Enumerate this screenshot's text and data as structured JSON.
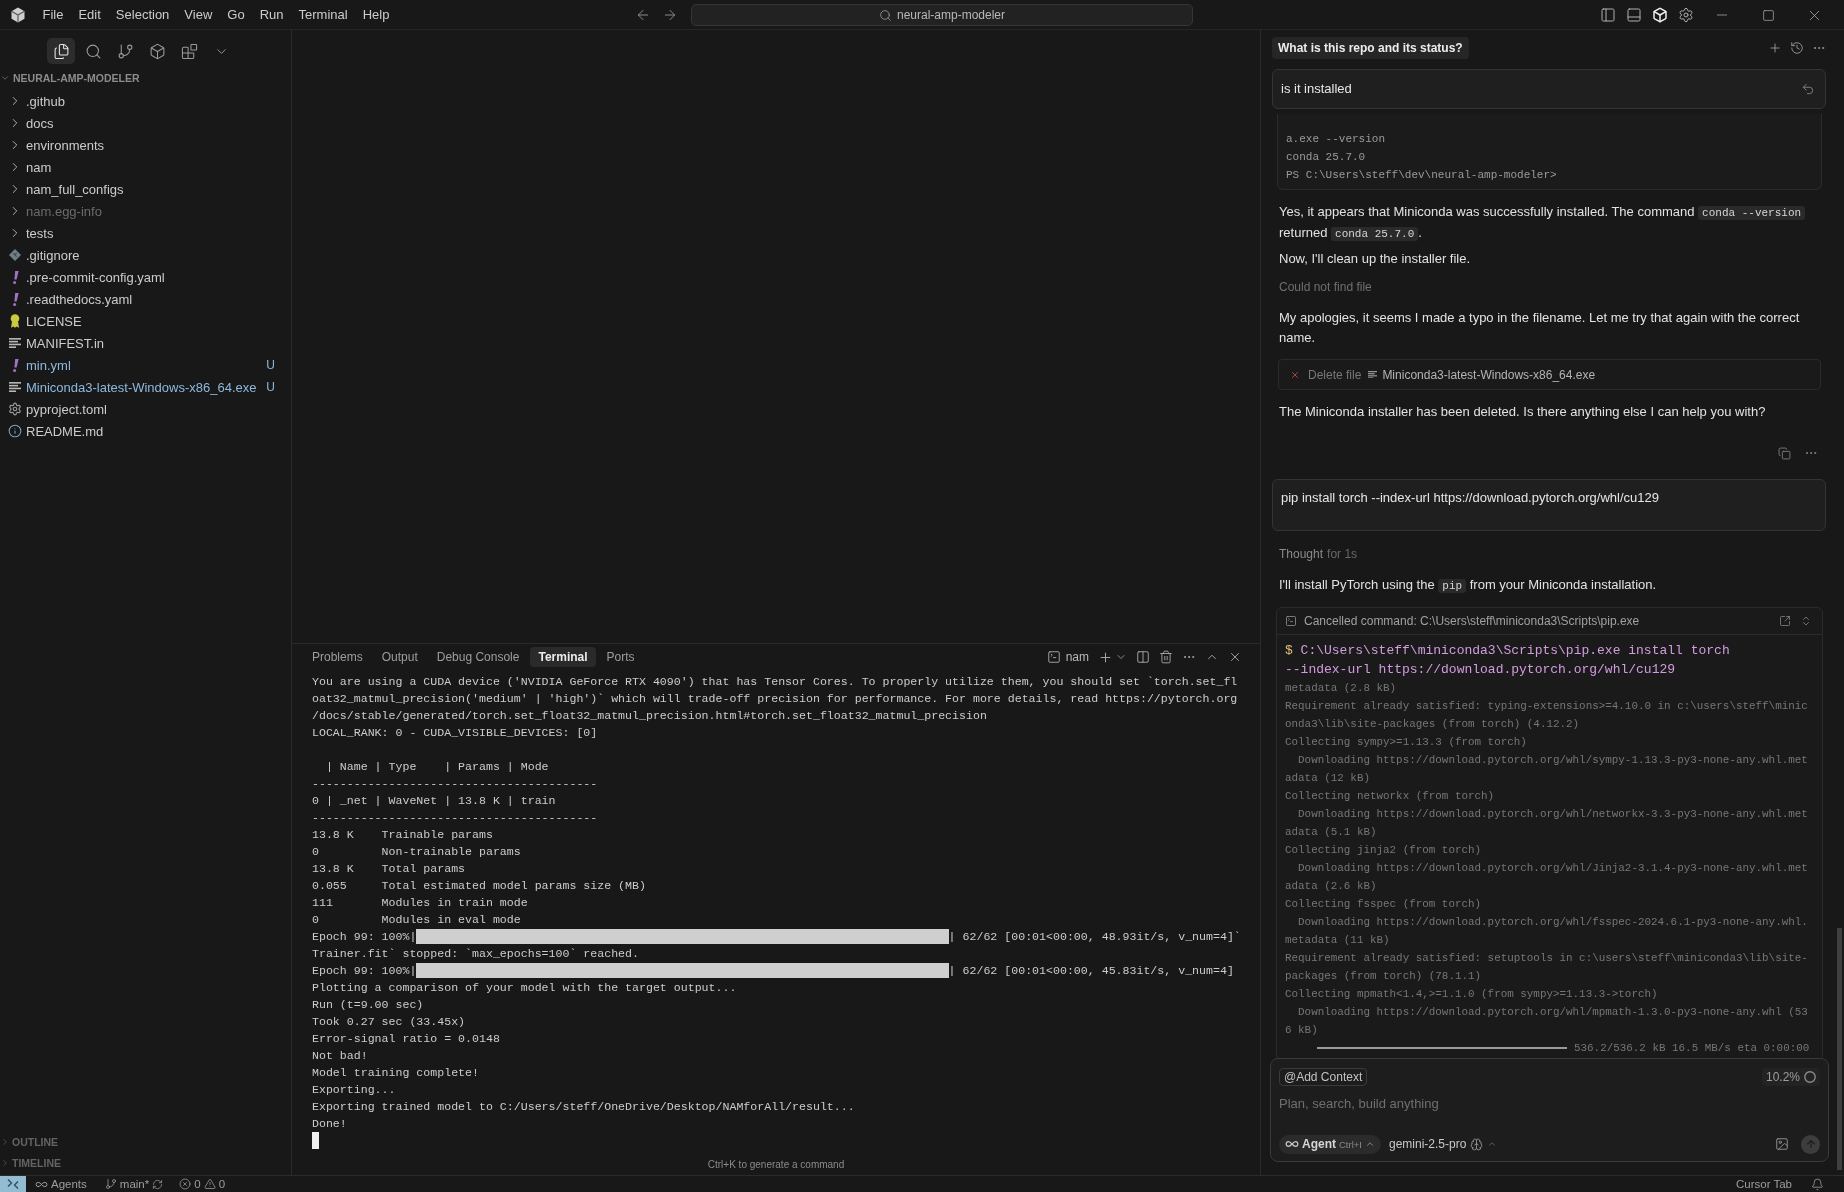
{
  "title_bar": {
    "menu": [
      "File",
      "Edit",
      "Selection",
      "View",
      "Go",
      "Run",
      "Terminal",
      "Help"
    ],
    "search": "neural-amp-modeler"
  },
  "view_bar": [
    {
      "kind": "explorer",
      "selected": true
    },
    {
      "kind": "search",
      "selected": false
    },
    {
      "kind": "git",
      "selected": false
    },
    {
      "kind": "cube",
      "selected": false
    },
    {
      "kind": "grid",
      "selected": false
    }
  ],
  "sidebar": {
    "title": "NEURAL-AMP-MODELER",
    "expanded": true,
    "items": [
      {
        "name": ".github",
        "kind": "folder",
        "expanded": false,
        "ignored": false,
        "untracked": false
      },
      {
        "name": "docs",
        "kind": "folder",
        "expanded": false,
        "ignored": false,
        "untracked": false
      },
      {
        "name": "environments",
        "kind": "folder",
        "expanded": false,
        "ignored": false,
        "untracked": false
      },
      {
        "name": "nam",
        "kind": "folder",
        "expanded": false,
        "ignored": false,
        "untracked": false
      },
      {
        "name": "nam_full_configs",
        "kind": "folder",
        "expanded": false,
        "ignored": false,
        "untracked": false
      },
      {
        "name": "nam.egg-info",
        "kind": "folder",
        "expanded": false,
        "ignored": true,
        "untracked": false
      },
      {
        "name": "tests",
        "kind": "folder",
        "expanded": false,
        "ignored": false,
        "untracked": false
      },
      {
        "name": ".gitignore",
        "kind": "git",
        "ignored": false,
        "untracked": false
      },
      {
        "name": ".pre-commit-config.yaml",
        "kind": "yaml",
        "ignored": false,
        "untracked": false
      },
      {
        "name": ".readthedocs.yaml",
        "kind": "yaml",
        "ignored": false,
        "untracked": false
      },
      {
        "name": "LICENSE",
        "kind": "license",
        "ignored": false,
        "untracked": false
      },
      {
        "name": "MANIFEST.in",
        "kind": "text",
        "ignored": false,
        "untracked": false
      },
      {
        "name": "min.yml",
        "kind": "yaml",
        "ignored": false,
        "untracked": true,
        "badge": "U"
      },
      {
        "name": "Miniconda3-latest-Windows-x86_64.exe",
        "kind": "text",
        "ignored": false,
        "untracked": true,
        "badge": "U"
      },
      {
        "name": "pyproject.toml",
        "kind": "toml",
        "ignored": false,
        "untracked": false
      },
      {
        "name": "README.md",
        "kind": "info",
        "ignored": false,
        "untracked": false
      }
    ],
    "sections": [
      {
        "title": "OUTLINE",
        "expanded": false
      },
      {
        "title": "TIMELINE",
        "expanded": false
      }
    ]
  },
  "panel": {
    "tabs": [
      {
        "label": "Problems",
        "selected": false
      },
      {
        "label": "Output",
        "selected": false
      },
      {
        "label": "Debug Console",
        "selected": false
      },
      {
        "label": "Terminal",
        "selected": true
      },
      {
        "label": "Ports",
        "selected": false
      }
    ],
    "shell": "nam",
    "lines": [
      {
        "kind": "text",
        "text": "You are using a CUDA device ('NVIDIA GeForce RTX 4090') that has Tensor Cores. To properly utilize them, you should set `torch.set_fl"
      },
      {
        "kind": "text",
        "text": "oat32_matmul_precision('medium' | 'high')` which will trade-off precision for performance. For more details, read https://pytorch.org"
      },
      {
        "kind": "text",
        "text": "/docs/stable/generated/torch.set_float32_matmul_precision.html#torch.set_float32_matmul_precision"
      },
      {
        "kind": "text",
        "text": "LOCAL_RANK: 0 - CUDA_VISIBLE_DEVICES: [0]"
      },
      {
        "kind": "blank"
      },
      {
        "kind": "text",
        "text": "  | Name | Type    | Params | Mode"
      },
      {
        "kind": "text",
        "text": "-----------------------------------------"
      },
      {
        "kind": "text",
        "text": "0 | _net | WaveNet | 13.8 K | train"
      },
      {
        "kind": "text",
        "text": "-----------------------------------------"
      },
      {
        "kind": "text",
        "text": "13.8 K    Trainable params"
      },
      {
        "kind": "text",
        "text": "0         Non-trainable params"
      },
      {
        "kind": "text",
        "text": "13.8 K    Total params"
      },
      {
        "kind": "text",
        "text": "0.055     Total estimated model params size (MB)"
      },
      {
        "kind": "text",
        "text": "111       Modules in train mode"
      },
      {
        "kind": "text",
        "text": "0         Modules in eval mode"
      },
      {
        "kind": "progress",
        "prefix": "Epoch 99: 100%|",
        "level": 1,
        "suffix": "| 62/62 [00:01<00:00, 48.93it/s, v_num=4]`"
      },
      {
        "kind": "text",
        "text": "Trainer.fit` stopped: `max_epochs=100` reached."
      },
      {
        "kind": "progress",
        "prefix": "Epoch 99: 100%|",
        "level": 1,
        "suffix": "| 62/62 [00:01<00:00, 45.83it/s, v_num=4]"
      },
      {
        "kind": "text",
        "text": "Plotting a comparison of your model with the target output..."
      },
      {
        "kind": "text",
        "text": "Run (t=9.00 sec)"
      },
      {
        "kind": "text",
        "text": "Took 0.27 sec (33.45x)"
      },
      {
        "kind": "text",
        "text": "Error-signal ratio = 0.0148"
      },
      {
        "kind": "text",
        "text": "Not bad!"
      },
      {
        "kind": "text",
        "text": "Model training complete!"
      },
      {
        "kind": "text",
        "text": "Exporting..."
      },
      {
        "kind": "text",
        "text": "Exporting trained model to C:/Users/steff/OneDrive/Desktop/NAMforAll/result..."
      },
      {
        "kind": "text",
        "text": "Done!"
      },
      {
        "kind": "cursor"
      }
    ],
    "hint": "Ctrl+K to generate a command"
  },
  "chat": {
    "title": "What is this repo and its status?",
    "blocks": [
      {
        "kind": "user",
        "text": "is it installed",
        "restorable": true
      },
      {
        "kind": "output",
        "lines": [
          "a.exe --version",
          "conda 25.7.0",
          "PS C:\\Users\\steff\\dev\\neural-amp-modeler>"
        ]
      },
      {
        "kind": "text",
        "parts": [
          {
            "kind": "plain",
            "text": "Yes, it appears that Miniconda was successfully installed. The command "
          },
          {
            "kind": "code",
            "text": "conda --version"
          },
          {
            "kind": "plain",
            "text": " returned "
          },
          {
            "kind": "code",
            "text": "conda 25.7.0"
          },
          {
            "kind": "plain",
            "text": "."
          }
        ]
      },
      {
        "kind": "text",
        "parts": [
          {
            "kind": "plain",
            "text": "Now, I'll clean up the installer file."
          }
        ]
      },
      {
        "kind": "note",
        "text": "Could not find file"
      },
      {
        "kind": "text",
        "parts": [
          {
            "kind": "plain",
            "text": "My apologies, it seems I made a typo in the filename. Let me try that again with the correct name."
          }
        ]
      },
      {
        "kind": "file_action",
        "action": "Delete file",
        "file": "Miniconda3-latest-Windows-x86_64.exe"
      },
      {
        "kind": "text",
        "parts": [
          {
            "kind": "plain",
            "text": "The Miniconda installer has been deleted. Is there anything else I can help you with?"
          }
        ]
      },
      {
        "kind": "actions"
      },
      {
        "kind": "user",
        "text": "pip install torch --index-url https://download.pytorch.org/whl/cu129",
        "restorable": false
      },
      {
        "kind": "thought",
        "label": "Thought",
        "duration": "for 1s"
      },
      {
        "kind": "text",
        "parts": [
          {
            "kind": "plain",
            "text": "I'll install PyTorch using the "
          },
          {
            "kind": "code",
            "text": "pip"
          },
          {
            "kind": "plain",
            "text": " from your Miniconda installation."
          }
        ]
      },
      {
        "kind": "command",
        "status": "Cancelled command: C:\\Users\\steff\\miniconda3\\Scripts\\pip.exe",
        "prompt": "$",
        "command": [
          "C:\\Users\\steff\\miniconda3\\Scripts\\pip.exe install torch",
          "--index-url https://download.pytorch.org/whl/cu129"
        ],
        "output": [
          "metadata (2.8 kB)",
          "Requirement already satisfied: typing-extensions>=4.10.0 in c:\\users\\steff\\minic",
          "onda3\\lib\\site-packages (from torch) (4.12.2)",
          "Collecting sympy>=1.13.3 (from torch)",
          "  Downloading https://download.pytorch.org/whl/sympy-1.13.3-py3-none-any.whl.met",
          "adata (12 kB)",
          "Collecting networkx (from torch)",
          "  Downloading https://download.pytorch.org/whl/networkx-3.3-py3-none-any.whl.met",
          "adata (5.1 kB)",
          "Collecting jinja2 (from torch)",
          "  Downloading https://download.pytorch.org/whl/Jinja2-3.1.4-py3-none-any.whl.met",
          "adata (2.6 kB)",
          "Collecting fsspec (from torch)",
          "  Downloading https://download.pytorch.org/whl/fsspec-2024.6.1-py3-none-any.whl.",
          "metadata (11 kB)",
          "Requirement already satisfied: setuptools in c:\\users\\steff\\miniconda3\\lib\\site-",
          "packages (from torch) (78.1.1)",
          "Collecting mpmath<1.4,>=1.1.0 (from sympy>=1.13.3->torch)",
          "  Downloading https://download.pytorch.org/whl/mpmath-1.3.0-py3-none-any.whl (53",
          "6 kB)"
        ],
        "progress": {
          "level": 1,
          "reading": "536.2/536.2 kB 16.5 MB/s eta 0:00:00"
        }
      }
    ],
    "composer": {
      "context_button": "@Add Context",
      "usage": "10.2%",
      "placeholder": "Plan, search, build anything",
      "mode": "Agent",
      "mode_shortcut": "Ctrl+I",
      "model": "gemini-2.5-pro"
    }
  },
  "status_bar": {
    "agents": "Agents",
    "branch": "main*",
    "errors": "0",
    "warnings": "0",
    "tab_mode": "Cursor Tab"
  }
}
